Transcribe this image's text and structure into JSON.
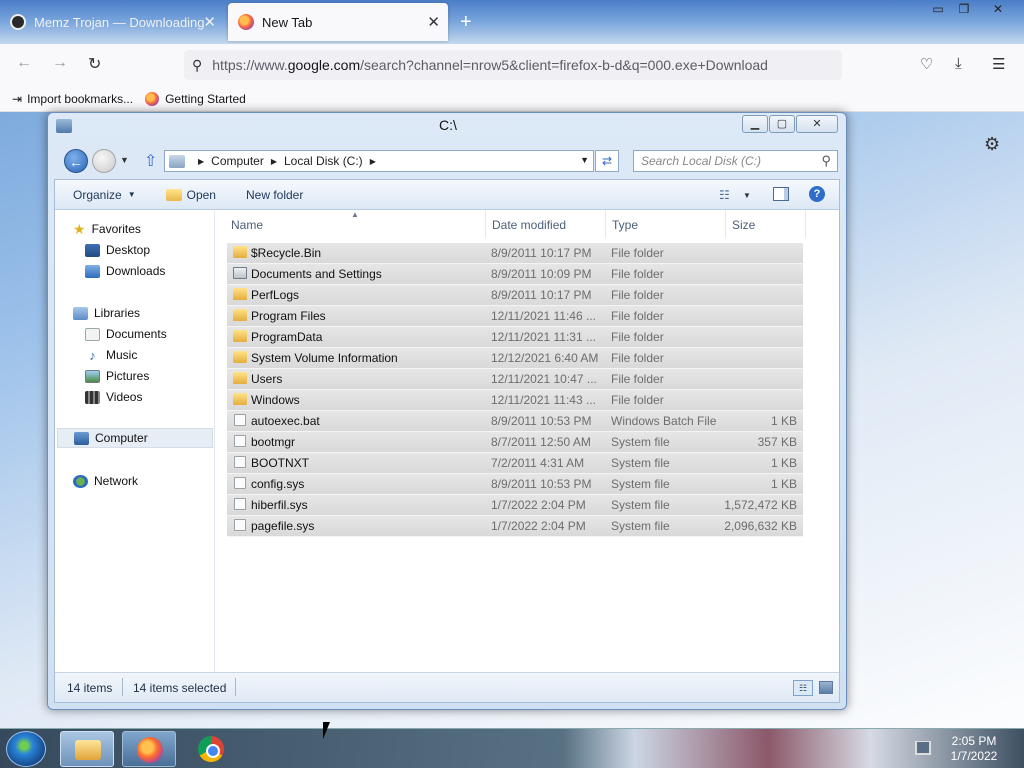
{
  "browser": {
    "tabs": [
      {
        "title": "Memz Trojan — Downloading"
      },
      {
        "title": "New Tab"
      }
    ],
    "url": {
      "prefix": "https://www.",
      "host": "google.com",
      "path": "/search?channel=nrow5&client=firefox-b-d&q=000.exe+Download"
    },
    "bookmarks": [
      {
        "label": "Import bookmarks..."
      },
      {
        "label": "Getting Started"
      }
    ]
  },
  "explorer": {
    "title": "C:\\",
    "breadcrumb": [
      "Computer",
      "Local Disk (C:)"
    ],
    "search_placeholder": "Search Local Disk (C:)",
    "toolbar": {
      "organize": "Organize",
      "open": "Open",
      "new_folder": "New folder"
    },
    "nav": {
      "favorites": "Favorites",
      "desktop": "Desktop",
      "downloads": "Downloads",
      "libraries": "Libraries",
      "documents": "Documents",
      "music": "Music",
      "pictures": "Pictures",
      "videos": "Videos",
      "computer": "Computer",
      "network": "Network"
    },
    "columns": {
      "name": "Name",
      "date": "Date modified",
      "type": "Type",
      "size": "Size"
    },
    "files": [
      {
        "name": "$Recycle.Bin",
        "date": "8/9/2011 10:17 PM",
        "type": "File folder",
        "size": "",
        "icon": "folder-icon"
      },
      {
        "name": "Documents and Settings",
        "date": "8/9/2011 10:09 PM",
        "type": "File folder",
        "size": "",
        "icon": "shortcut-folder-icon"
      },
      {
        "name": "PerfLogs",
        "date": "8/9/2011 10:17 PM",
        "type": "File folder",
        "size": "",
        "icon": "folder-icon"
      },
      {
        "name": "Program Files",
        "date": "12/11/2021 11:46 ...",
        "type": "File folder",
        "size": "",
        "icon": "folder-icon"
      },
      {
        "name": "ProgramData",
        "date": "12/11/2021 11:31 ...",
        "type": "File folder",
        "size": "",
        "icon": "folder-icon"
      },
      {
        "name": "System Volume Information",
        "date": "12/12/2021 6:40 AM",
        "type": "File folder",
        "size": "",
        "icon": "folder-icon"
      },
      {
        "name": "Users",
        "date": "12/11/2021 10:47 ...",
        "type": "File folder",
        "size": "",
        "icon": "folder-icon"
      },
      {
        "name": "Windows",
        "date": "12/11/2021 11:43 ...",
        "type": "File folder",
        "size": "",
        "icon": "folder-icon"
      },
      {
        "name": "autoexec.bat",
        "date": "8/9/2011 10:53 PM",
        "type": "Windows Batch File",
        "size": "1 KB",
        "icon": "file-icon"
      },
      {
        "name": "bootmgr",
        "date": "8/7/2011 12:50 AM",
        "type": "System file",
        "size": "357 KB",
        "icon": "file-icon"
      },
      {
        "name": "BOOTNXT",
        "date": "7/2/2011 4:31 AM",
        "type": "System file",
        "size": "1 KB",
        "icon": "file-icon"
      },
      {
        "name": "config.sys",
        "date": "8/9/2011 10:53 PM",
        "type": "System file",
        "size": "1 KB",
        "icon": "file-icon"
      },
      {
        "name": "hiberfil.sys",
        "date": "1/7/2022 2:04 PM",
        "type": "System file",
        "size": "1,572,472 KB",
        "icon": "file-icon"
      },
      {
        "name": "pagefile.sys",
        "date": "1/7/2022 2:04 PM",
        "type": "System file",
        "size": "2,096,632 KB",
        "icon": "file-icon"
      }
    ],
    "status": {
      "count": "14 items",
      "selected": "14 items selected"
    }
  },
  "taskbar": {
    "time": "2:05 PM",
    "date": "1/7/2022"
  }
}
